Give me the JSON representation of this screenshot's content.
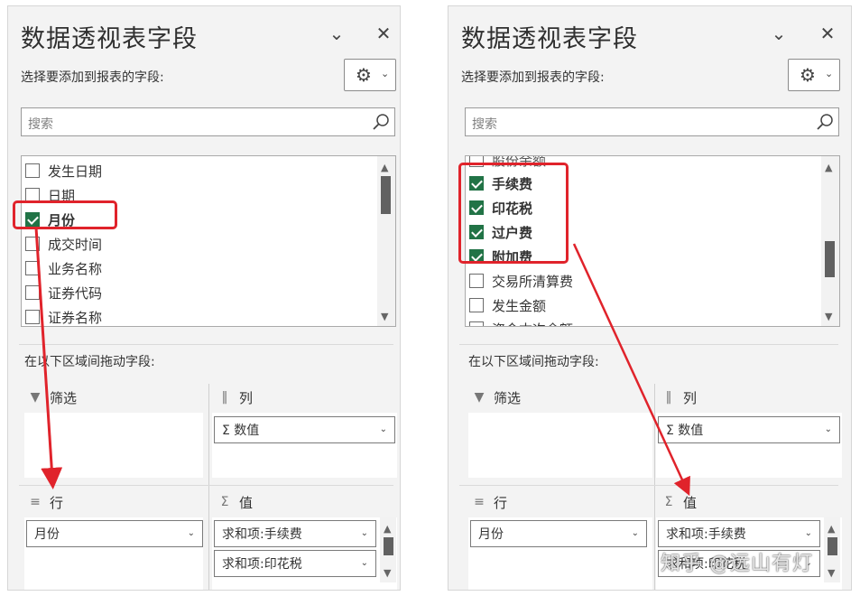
{
  "left_panel": {
    "title": "数据透视表字段",
    "subtitle": "选择要添加到报表的字段:",
    "search_placeholder": "搜索",
    "fields": [
      {
        "label": "发生日期",
        "checked": false,
        "bold": false
      },
      {
        "label": "日期",
        "checked": false,
        "bold": false
      },
      {
        "label": "月份",
        "checked": true,
        "bold": true
      },
      {
        "label": "成交时间",
        "checked": false,
        "bold": false
      },
      {
        "label": "业务名称",
        "checked": false,
        "bold": false
      },
      {
        "label": "证券代码",
        "checked": false,
        "bold": false
      },
      {
        "label": "证券名称",
        "checked": false,
        "bold": false
      }
    ],
    "drag_label": "在以下区域间拖动字段:",
    "areas": {
      "filter": "筛选",
      "columns": "列",
      "rows": "行",
      "values": "值"
    },
    "columns_items": [
      "Σ 数值"
    ],
    "rows_items": [
      "月份"
    ],
    "values_items": [
      "求和项:手续费",
      "求和项:印花税"
    ]
  },
  "right_panel": {
    "title": "数据透视表字段",
    "subtitle": "选择要添加到报表的字段:",
    "search_placeholder": "搜索",
    "fields": [
      {
        "label": "股份余额",
        "checked": false,
        "bold": false
      },
      {
        "label": "手续费",
        "checked": true,
        "bold": true
      },
      {
        "label": "印花税",
        "checked": true,
        "bold": true
      },
      {
        "label": "过户费",
        "checked": true,
        "bold": true
      },
      {
        "label": "附加费",
        "checked": true,
        "bold": true
      },
      {
        "label": "交易所清算费",
        "checked": false,
        "bold": false
      },
      {
        "label": "发生金额",
        "checked": false,
        "bold": false
      },
      {
        "label": "资金本次余额",
        "checked": false,
        "bold": false
      }
    ],
    "drag_label": "在以下区域间拖动字段:",
    "areas": {
      "filter": "筛选",
      "columns": "列",
      "rows": "行",
      "values": "值"
    },
    "columns_items": [
      "Σ 数值"
    ],
    "rows_items": [
      "月份"
    ],
    "values_items": [
      "求和项:手续费",
      "求和项:印花税"
    ]
  },
  "icons": {
    "collapse": "chevron-down-icon",
    "close": "close-icon",
    "settings": "gear-icon",
    "search": "magnifier-icon",
    "filter": "funnel-icon",
    "columns": "columns-icon",
    "rows": "rows-icon",
    "values": "sigma-icon"
  },
  "colors": {
    "check": "#217346",
    "highlight": "#e0232b"
  },
  "watermark": "知乎 @远山有灯"
}
